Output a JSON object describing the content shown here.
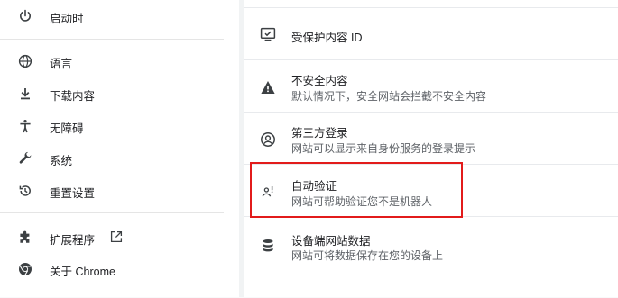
{
  "sidebar": {
    "items": [
      {
        "label": "启动时",
        "icon": "power-icon"
      },
      {
        "label": "语言",
        "icon": "globe-icon"
      },
      {
        "label": "下载内容",
        "icon": "download-icon"
      },
      {
        "label": "无障碍",
        "icon": "accessibility-icon"
      },
      {
        "label": "系统",
        "icon": "wrench-icon"
      },
      {
        "label": "重置设置",
        "icon": "reset-history-icon"
      },
      {
        "label": "扩展程序",
        "icon": "puzzle-icon"
      },
      {
        "label": "关于 Chrome",
        "icon": "chrome-icon"
      }
    ]
  },
  "content": {
    "rows": [
      {
        "title": "受保护内容 ID",
        "subtitle": "",
        "icon": "protected-content-icon"
      },
      {
        "title": "不安全内容",
        "subtitle": "默认情况下，安全网站会拦截不安全内容",
        "icon": "warning-icon"
      },
      {
        "title": "第三方登录",
        "subtitle": "网站可以显示来自身份服务的登录提示",
        "icon": "account-circle-icon"
      },
      {
        "title": "自动验证",
        "subtitle": "网站可帮助验证您不是机器人",
        "icon": "person-verify-icon"
      },
      {
        "title": "设备端网站数据",
        "subtitle": "网站可将数据保存在您的设备上",
        "icon": "database-icon"
      }
    ]
  },
  "colors": {
    "highlight": "#e21b1b",
    "icon": "#3c4043"
  }
}
